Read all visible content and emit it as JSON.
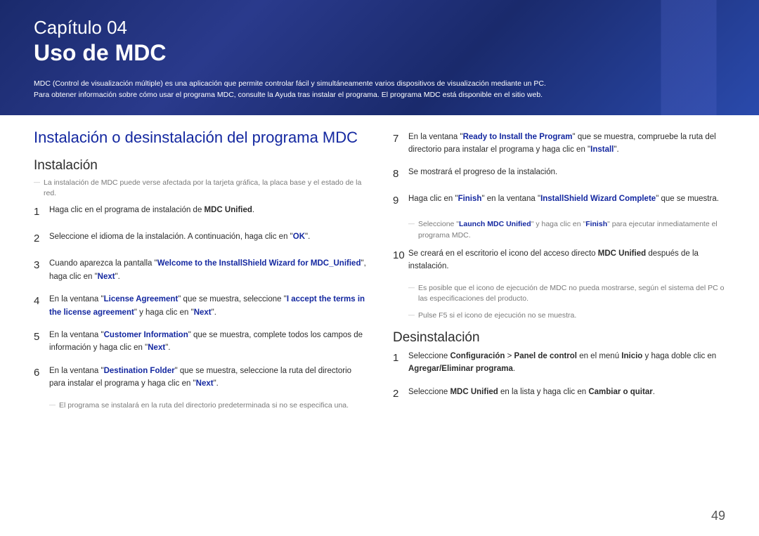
{
  "header": {
    "chapterLabel": "Capítulo 04",
    "chapterTitle": "Uso de MDC",
    "introLine1": "MDC (Control de visualización múltiple) es una aplicación que permite controlar fácil y simultáneamente varios dispositivos de visualización mediante un PC.",
    "introLine2": "Para obtener información sobre cómo usar el programa MDC, consulte la Ayuda tras instalar el programa. El programa MDC está disponible en el sitio web."
  },
  "left": {
    "sectionTitle": "Instalación o desinstalación del programa MDC",
    "subInstall": "Instalación",
    "installNote": "La instalación de MDC puede verse afectada por la tarjeta gráfica, la placa base y el estado de la red.",
    "steps": {
      "s1_a": "Haga clic en el programa de instalación de ",
      "s1_b": "MDC Unified",
      "s1_c": ".",
      "s2_a": "Seleccione el idioma de la instalación. A continuación, haga clic en \"",
      "s2_b": "OK",
      "s2_c": "\".",
      "s3_a": "Cuando aparezca la pantalla \"",
      "s3_b": "Welcome to the InstallShield Wizard for MDC_Unified",
      "s3_c": "\", haga clic en \"",
      "s3_d": "Next",
      "s3_e": "\".",
      "s4_a": "En la ventana \"",
      "s4_b": "License Agreement",
      "s4_c": "\" que se muestra, seleccione \"",
      "s4_d": "I accept the terms in the license agreement",
      "s4_e": "\" y haga clic en \"",
      "s4_f": "Next",
      "s4_g": "\".",
      "s5_a": "En la ventana \"",
      "s5_b": "Customer Information",
      "s5_c": "\" que se muestra, complete todos los campos de información y haga clic en \"",
      "s5_d": "Next",
      "s5_e": "\".",
      "s6_a": "En la ventana \"",
      "s6_b": "Destination Folder",
      "s6_c": "\" que se muestra, seleccione la ruta del directorio para instalar el programa y haga clic en \"",
      "s6_d": "Next",
      "s6_e": "\"."
    },
    "bottomNote": "El programa se instalará en la ruta del directorio predeterminada si no se especifica una."
  },
  "right": {
    "steps": {
      "s7_a": "En la ventana \"",
      "s7_b": "Ready to Install the Program",
      "s7_c": "\" que se muestra, compruebe la ruta del directorio para instalar el programa y haga clic en \"",
      "s7_d": "Install",
      "s7_e": "\".",
      "s8": "Se mostrará el progreso de la instalación.",
      "s9_a": "Haga clic en \"",
      "s9_b": "Finish",
      "s9_c": "\" en la ventana \"",
      "s9_d": "InstallShield Wizard Complete",
      "s9_e": "\" que se muestra.",
      "s9note_a": "Seleccione \"",
      "s9note_b": "Launch MDC Unified",
      "s9note_c": "\" y haga clic en \"",
      "s9note_d": "Finish",
      "s9note_e": "\" para ejecutar inmediatamente el programa MDC.",
      "s10_a": "Se creará en el escritorio el icono del acceso directo ",
      "s10_b": "MDC Unified",
      "s10_c": " después de la instalación.",
      "s10note1": "Es posible que el icono de ejecución de MDC no pueda mostrarse, según el sistema del PC o las especificaciones del producto.",
      "s10note2": "Pulse F5 si el icono de ejecución no se muestra."
    },
    "subUninstall": "Desinstalación",
    "uninstall": {
      "u1_a": "Seleccione ",
      "u1_b": "Configuración",
      "u1_c": " > ",
      "u1_d": "Panel de control",
      "u1_e": " en el menú ",
      "u1_f": "Inicio",
      "u1_g": " y haga doble clic en ",
      "u1_h": "Agregar/Eliminar programa",
      "u1_i": ".",
      "u2_a": "Seleccione ",
      "u2_b": "MDC Unified",
      "u2_c": " en la lista y haga clic en ",
      "u2_d": "Cambiar o quitar",
      "u2_e": "."
    }
  },
  "pageNumber": "49"
}
